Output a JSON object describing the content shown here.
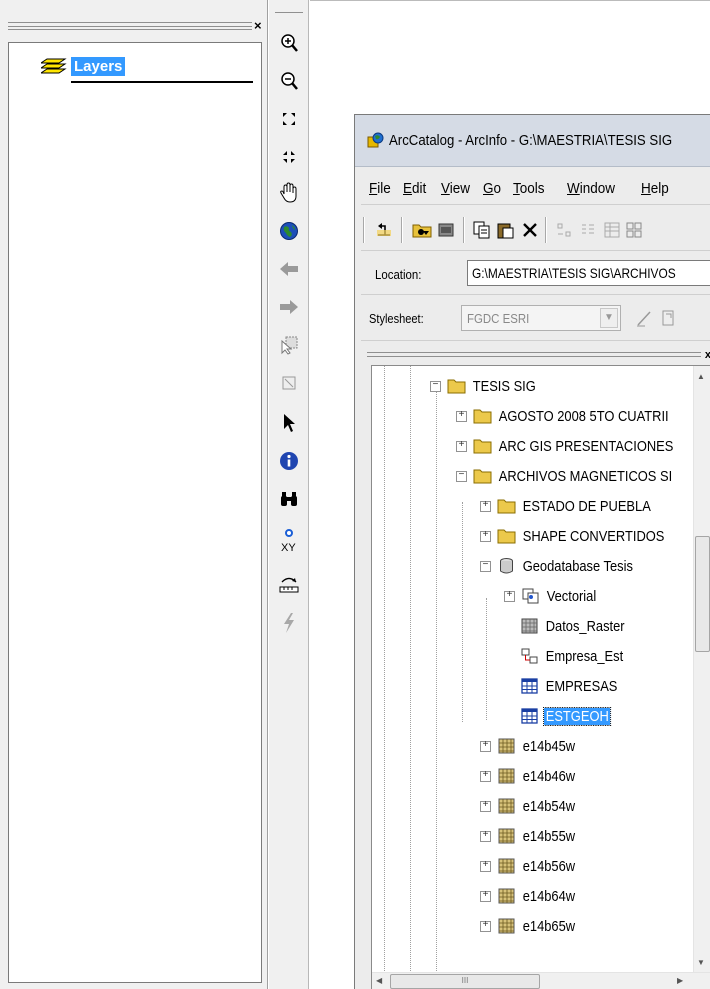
{
  "toc": {
    "close_glyph": "×",
    "layers_label": "Layers"
  },
  "arccatalog": {
    "title": "ArcCatalog - ArcInfo - G:\\MAESTRIA\\TESIS SIG",
    "menus": [
      {
        "pre": "",
        "u": "F",
        "post": "ile"
      },
      {
        "pre": "",
        "u": "E",
        "post": "dit"
      },
      {
        "pre": "",
        "u": "V",
        "post": "iew"
      },
      {
        "pre": "",
        "u": "G",
        "post": "o"
      },
      {
        "pre": "",
        "u": "T",
        "post": "ools"
      },
      {
        "pre": "",
        "u": "W",
        "post": "indow"
      },
      {
        "pre": "",
        "u": "H",
        "post": "elp"
      }
    ],
    "location_label": "Location:",
    "location_value": "G:\\MAESTRIA\\TESIS SIG\\ARCHIVOS",
    "stylesheet_label": "Stylesheet:",
    "stylesheet_value": "FGDC ESRI",
    "panel_close": "x",
    "tree": {
      "tesis_sig": "TESIS SIG",
      "agosto": "AGOSTO 2008 5TO CUATRII",
      "arc_gis": "ARC GIS PRESENTACIONES",
      "archivos": "ARCHIVOS MAGNETICOS SI",
      "estado": "ESTADO DE PUEBLA",
      "shape": "SHAPE CONVERTIDOS",
      "geodb": "Geodatabase Tesis",
      "vectorial": "Vectorial",
      "datos_raster": "Datos_Raster",
      "empresa_est": "Empresa_Est",
      "empresas": "EMPRESAS",
      "estgeoh": "ESTGEOH",
      "rasters": [
        "e14b45w",
        "e14b46w",
        "e14b54w",
        "e14b55w",
        "e14b56w",
        "e14b64w",
        "e14b65w"
      ]
    },
    "hscroll_grip": "III"
  }
}
